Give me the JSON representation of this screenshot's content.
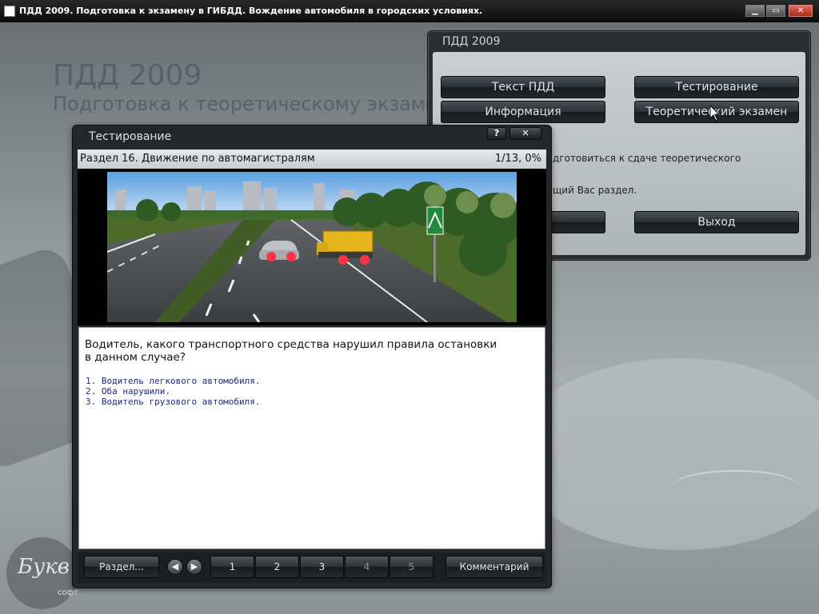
{
  "window": {
    "title": "ПДД 2009. Подготовка к экзамену в ГИБДД. Вождение автомобиля в городских условиях.",
    "minimize_label": "▁",
    "maximize_label": "▭",
    "close_label": "✕"
  },
  "background": {
    "title": "ПДД 2009",
    "subtitle": "Подготовка к теоретическому экзаменуу"
  },
  "logo": {
    "text": "Букв",
    "sub": "софт"
  },
  "main_panel": {
    "title": "ПДД 2009",
    "buttons": {
      "rules_text": "Текст ПДД",
      "testing": "Тестирование",
      "information": "Информация",
      "theory_exam": "Теоретический экзамен",
      "exit": "Выход"
    },
    "description_line1": "дготовиться к сдаче теоретического",
    "description_line2": "щий Вас раздел."
  },
  "test_dialog": {
    "title": "Тестирование",
    "help_label": "?",
    "close_label": "✕",
    "section": "Раздел 16. Движение по автомагистралям",
    "progress": "1/13, 0%",
    "question": "Водитель, какого транспортного средства нарушил правила остановки в данном случае?",
    "answers": [
      "1. Водитель легкового автомобиля.",
      "2. Оба нарушили.",
      "3. Водитель грузового автомобиля."
    ],
    "nav": {
      "section_button": "Раздел...",
      "prev_icon": "arrow-left-icon",
      "next_icon": "arrow-right-icon",
      "pages": [
        "1",
        "2",
        "3",
        "4",
        "5"
      ],
      "comment_button": "Комментарий"
    }
  }
}
